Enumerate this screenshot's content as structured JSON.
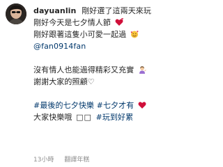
{
  "post": {
    "username": "dayuanlin",
    "line1": "剛好選了這兩天來玩",
    "line2": "剛好今天是七夕情人節",
    "line3": "剛好跟著這隻小可愛一起過",
    "mention": "@fan0914fan",
    "line5": "沒有情人也能過得精彩又充實",
    "line6": "謝謝大家的照顧♡",
    "hashtag1": "#最後的七夕快樂",
    "hashtag2": "#七夕才有",
    "line8_text": "大家快樂哦",
    "line8_boxes": "□□",
    "hashtag3": "#玩到好累",
    "emojis": [
      "heart-emoji",
      "smiling-face-hearts-emoji",
      "person-tipping-hand-emoji",
      "red-heart-emoji"
    ]
  },
  "footer": {
    "time": "13小時",
    "translate": "翻譯年糕"
  },
  "colors": {
    "text": "#262626",
    "link": "#00376b",
    "meta": "#8e8e8e",
    "heart": "#d0103a"
  }
}
